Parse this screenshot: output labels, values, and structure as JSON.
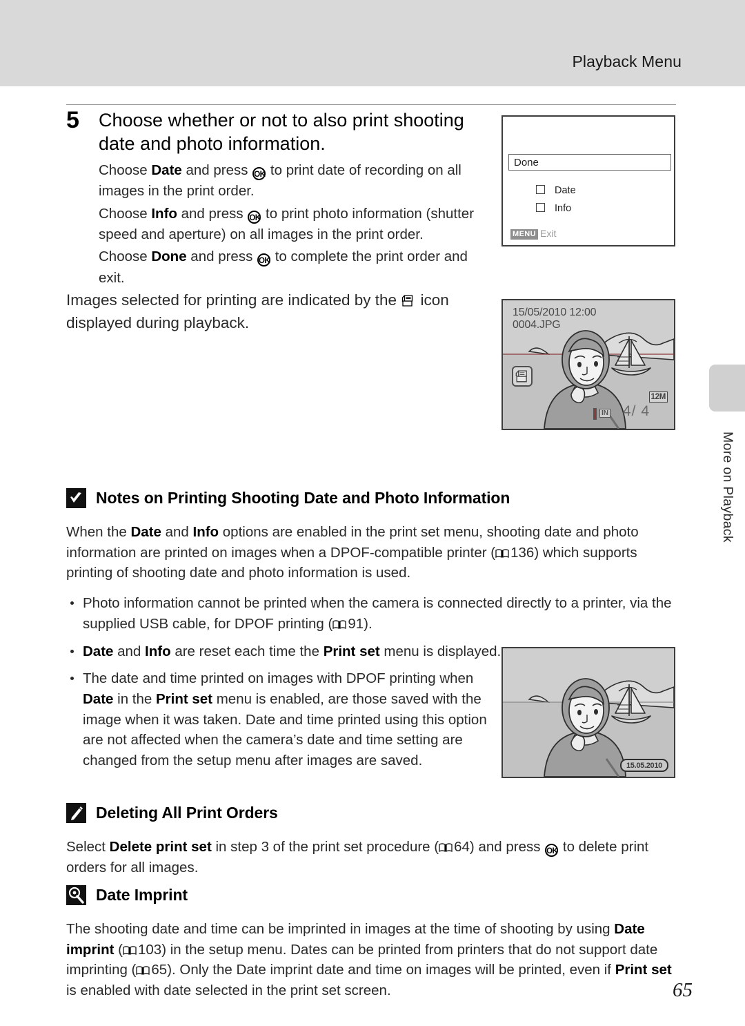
{
  "header": {
    "title": "Playback Menu"
  },
  "side_tab": {
    "label": "More on Playback"
  },
  "page_number": "65",
  "step": {
    "number": "5",
    "title": "Choose whether or not to also print shooting date and photo information.",
    "paragraph_1_pre": "Choose ",
    "paragraph_1_b1": "Date",
    "paragraph_1_mid": " and press ",
    "paragraph_1_post": " to print date of recording on all images in the print order.",
    "paragraph_2_pre": "Choose ",
    "paragraph_2_b1": "Info",
    "paragraph_2_mid": " and press ",
    "paragraph_2_post": " to print photo information (shutter speed and aperture) on all images in the print order.",
    "paragraph_3_pre": "Choose ",
    "paragraph_3_b1": "Done",
    "paragraph_3_mid": " and press ",
    "paragraph_3_post": " to complete the print order and exit.",
    "wide_pre": "Images selected for printing are indicated by the ",
    "wide_post": " icon displayed during playback."
  },
  "camera_screen_print_set": {
    "done_label": "Done",
    "option_date": "Date",
    "option_info": "Info",
    "menu_badge": "MENU",
    "exit_label": "Exit"
  },
  "camera_screen_playback": {
    "datetime": "15/05/2010 12:00",
    "filename": "0004.JPG",
    "memory_label": "IN",
    "frame_counter": "4/ 4",
    "image_size": "12M"
  },
  "camera_screen_imprint": {
    "date_stamp": "15.05.2010"
  },
  "notes_printing": {
    "icon": "caution-check-icon",
    "title": "Notes on Printing Shooting Date and Photo Information",
    "intro_1": "When the ",
    "intro_b1": "Date",
    "intro_2": " and ",
    "intro_b2": "Info",
    "intro_3": " options are enabled in the print set menu, shooting date and photo information are printed on images when a DPOF-compatible printer (",
    "intro_ref_1": "136",
    "intro_4": ") which supports printing of shooting date and photo information is used.",
    "bullets": [
      {
        "text_1": "Photo information cannot be printed when the camera is connected directly to a printer, via the supplied USB cable, for DPOF printing (",
        "ref": "91",
        "text_2": ")."
      },
      {
        "b1": "Date",
        "text_1": " and ",
        "b2": "Info",
        "text_2": " are reset each time the ",
        "b3": "Print set",
        "text_3": " menu is displayed."
      },
      {
        "text_1": "The date and time printed on images with DPOF printing when ",
        "b1": "Date",
        "text_2": " in the ",
        "b2": "Print set",
        "text_3": " menu is enabled, are those saved with the image when it was taken. Date and time printed using this option are not affected when the camera’s date and time setting are changed from the setup menu after images are saved."
      }
    ]
  },
  "deleting_orders": {
    "icon": "pencil-note-icon",
    "title": "Deleting All Print Orders",
    "text_1": "Select ",
    "b1": "Delete print set",
    "text_2": " in step 3 of the print set procedure (",
    "ref": "64",
    "text_3": ") and press ",
    "text_4": " to delete print orders for all images."
  },
  "date_imprint": {
    "icon": "magnifier-note-icon",
    "title": "Date Imprint",
    "text_1": "The shooting date and time can be imprinted in images at the time of shooting by using ",
    "b1": "Date imprint",
    "text_2": " (",
    "ref_1": "103",
    "text_3": ") in the setup menu. Dates can be printed from printers that do not support date imprinting (",
    "ref_2": "65",
    "text_4": "). Only the Date imprint date and time on images will be printed, even if ",
    "b2": "Print set",
    "text_5": " is enabled with date selected in the print set screen."
  },
  "colors": {
    "header_band": "#d9d9d9",
    "side_tab": "#d0d0d0",
    "screen_border": "#3d3d3d",
    "photo_bg": "#cfcfcf"
  }
}
